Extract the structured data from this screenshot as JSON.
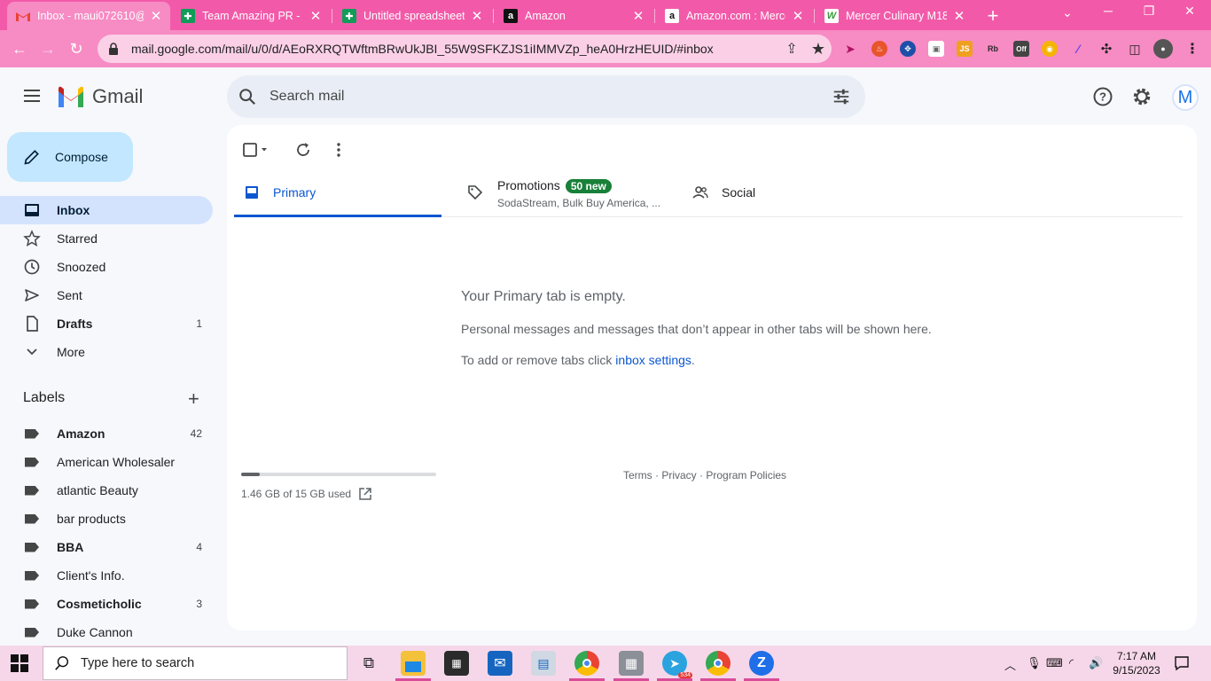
{
  "browser": {
    "tabs": [
      {
        "title": "Inbox - maui072610@",
        "favicon": "gmail-icon"
      },
      {
        "title": "Team Amazing PR - G",
        "favicon": "sheets-icon"
      },
      {
        "title": "Untitled spreadsheet -",
        "favicon": "sheets-icon"
      },
      {
        "title": "Amazon",
        "favicon": "amazon-icon"
      },
      {
        "title": "Amazon.com : Mercer",
        "favicon": "amazon-icon"
      },
      {
        "title": "Mercer Culinary M187",
        "favicon": "mercer-icon"
      }
    ],
    "url": "mail.google.com/mail/u/0/d/AEoRXRQTWftmBRwUkJBI_55W9SFKZJS1iIMMVZp_heA0HrzHEUID/#inbox",
    "ext_labels": {
      "js": "JS",
      "rb": "Rb",
      "off": "Off"
    }
  },
  "gmail": {
    "logo_text": "Gmail",
    "search_placeholder": "Search mail",
    "avatar_letter": "M",
    "compose_label": "Compose",
    "nav": [
      {
        "label": "Inbox",
        "count": ""
      },
      {
        "label": "Starred",
        "count": ""
      },
      {
        "label": "Snoozed",
        "count": ""
      },
      {
        "label": "Sent",
        "count": ""
      },
      {
        "label": "Drafts",
        "count": "1"
      },
      {
        "label": "More",
        "count": ""
      }
    ],
    "labels_heading": "Labels",
    "labels": [
      {
        "name": "Amazon",
        "count": "42"
      },
      {
        "name": "American Wholesaler",
        "count": ""
      },
      {
        "name": "atlantic Beauty",
        "count": ""
      },
      {
        "name": "bar products",
        "count": ""
      },
      {
        "name": "BBA",
        "count": "4"
      },
      {
        "name": "Client's Info.",
        "count": ""
      },
      {
        "name": "Cosmeticholic",
        "count": "3"
      },
      {
        "name": "Duke Cannon",
        "count": ""
      }
    ],
    "tabs": {
      "primary": "Primary",
      "promotions": "Promotions",
      "promotions_badge": "50 new",
      "promotions_sub": "SodaStream, Bulk Buy America, ...",
      "social": "Social"
    },
    "empty": {
      "title": "Your Primary tab is empty.",
      "desc": "Personal messages and messages that don’t appear in other tabs will be shown here.",
      "settings_prefix": "To add or remove tabs click ",
      "settings_link": "inbox settings",
      "settings_suffix": "."
    },
    "storage": {
      "text": "1.46 GB of 15 GB used",
      "fraction": 0.097
    },
    "footer": {
      "terms": "Terms",
      "privacy": "Privacy",
      "policies": "Program Policies",
      "sep": " · "
    }
  },
  "taskbar": {
    "search_placeholder": "Type here to search",
    "telegram_badge": "534",
    "time": "7:17 AM",
    "date": "9/15/2023"
  },
  "colors": {
    "tabbar": "#f25aa9",
    "toolbar": "#f78bc4",
    "accent": "#0b57d0",
    "compose": "#c2e7ff",
    "badge": "#188038"
  }
}
